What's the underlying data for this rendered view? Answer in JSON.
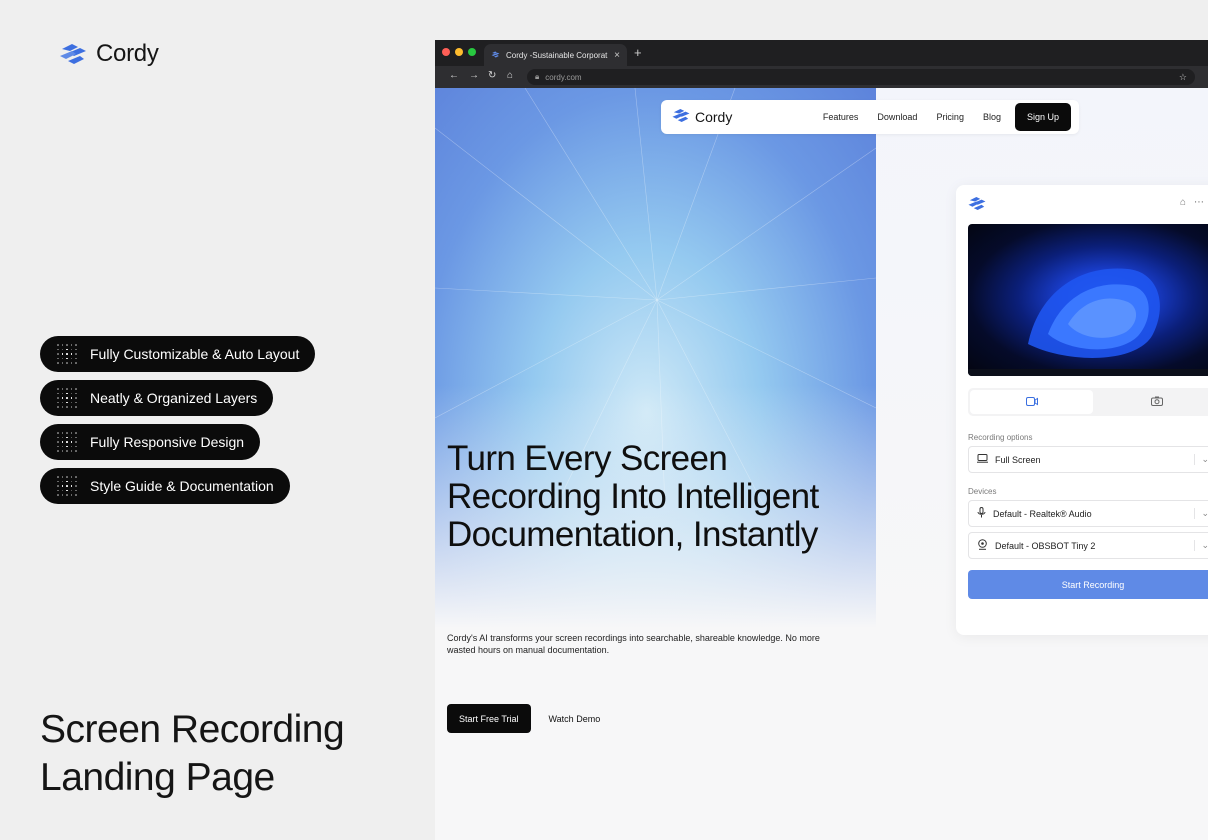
{
  "brand": {
    "name": "Cordy"
  },
  "features": [
    {
      "label": "Fully Customizable & Auto Layout"
    },
    {
      "label": "Neatly & Organized Layers"
    },
    {
      "label": "Fully Responsive Design"
    },
    {
      "label": "Style Guide & Documentation"
    }
  ],
  "page_title": {
    "line1": "Screen Recording",
    "line2": "Landing Page"
  },
  "browser": {
    "tab_title": "Cordy -Sustainable Corporat...",
    "url": "cordy.com",
    "traffic_colors": [
      "#ff5f57",
      "#febc2e",
      "#28c840"
    ]
  },
  "site": {
    "brand": "Cordy",
    "nav": [
      "Features",
      "Download",
      "Pricing",
      "Blog"
    ],
    "signup": "Sign Up",
    "headline": {
      "line1": "Turn Every Screen",
      "line2": "Recording Into Intelligent",
      "line3": "Documentation, Instantly"
    },
    "sub": {
      "line1": "Cordy's AI transforms your screen recordings into searchable, shareable knowledge. No more",
      "line2": "wasted hours on manual documentation."
    },
    "cta_primary": "Start Free Trial",
    "cta_secondary": "Watch Demo"
  },
  "app": {
    "recording_options_label": "Recording options",
    "recording_option": "Full Screen",
    "devices_label": "Devices",
    "audio_device": "Default - Realtek® Audio",
    "camera_device": "Default - OBSBOT Tiny 2",
    "start_button": "Start Recording",
    "icons": [
      "home-icon",
      "more-icon",
      "video-icon",
      "camera-icon",
      "monitor-icon",
      "microphone-icon",
      "webcam-icon"
    ]
  },
  "colors": {
    "accent": "#5f8ae6",
    "logo": "#3d6fe0",
    "dark": "#0b0b0b"
  }
}
